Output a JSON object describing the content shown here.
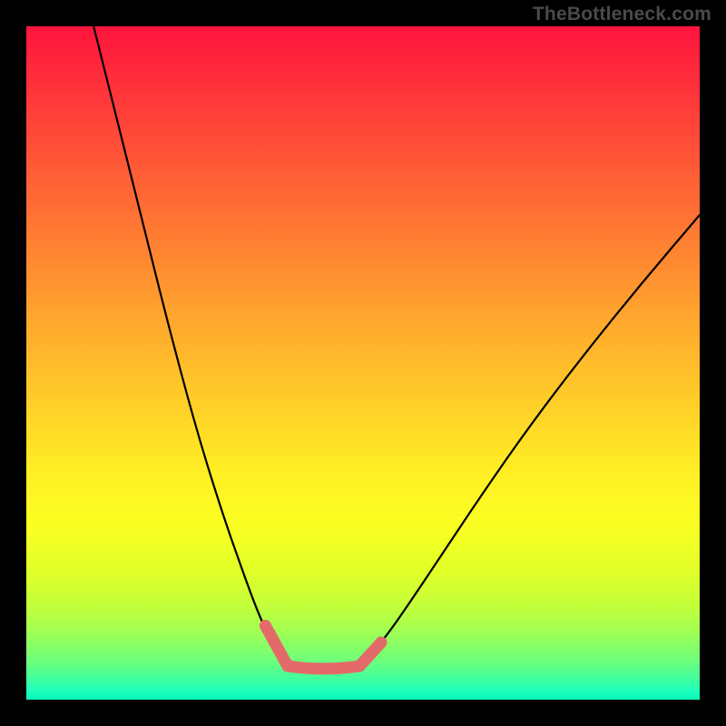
{
  "watermark": "TheBottleneck.com",
  "colors": {
    "curve_stroke": "#000000",
    "highlight_stroke": "#e46a6a",
    "background_frame": "#000000"
  },
  "chart_data": {
    "type": "line",
    "title": "",
    "xlabel": "",
    "ylabel": "",
    "xlim": [
      0,
      100
    ],
    "ylim": [
      0,
      100
    ],
    "grid": false,
    "note": "No axis ticks or numeric labels are rendered. The chart is a V-shaped bottleneck curve over a vertical red→green gradient. Values are read as percentages of the plot area (0,0 = top-left).",
    "series": [
      {
        "name": "left-branch",
        "x": [
          10.0,
          13.5,
          17.0,
          21.0,
          25.0,
          29.0,
          32.5,
          34.6,
          36.0,
          37.0,
          38.0,
          38.8
        ],
        "y": [
          0.0,
          14.0,
          28.0,
          44.0,
          59.0,
          72.0,
          82.0,
          87.5,
          90.5,
          92.5,
          94.0,
          95.0
        ]
      },
      {
        "name": "valley-floor",
        "x": [
          38.8,
          40.5,
          43.0,
          45.5,
          48.0,
          49.5
        ],
        "y": [
          95.0,
          95.7,
          96.0,
          96.0,
          95.6,
          95.0
        ]
      },
      {
        "name": "right-branch",
        "x": [
          49.5,
          51.0,
          53.5,
          57.0,
          62.0,
          68.0,
          75.0,
          83.0,
          91.5,
          100.0
        ],
        "y": [
          95.0,
          93.5,
          90.5,
          85.5,
          78.0,
          69.0,
          59.0,
          48.5,
          38.0,
          28.0
        ]
      }
    ],
    "highlighted_segments": [
      {
        "description": "left descent near valley",
        "x": [
          35.5,
          38.8
        ],
        "y": [
          89.0,
          95.0
        ]
      },
      {
        "description": "valley floor",
        "x": [
          38.8,
          49.5
        ],
        "y": [
          95.0,
          95.0
        ]
      },
      {
        "description": "right ascent near valley",
        "x": [
          49.5,
          52.7
        ],
        "y": [
          95.0,
          91.5
        ]
      }
    ]
  }
}
